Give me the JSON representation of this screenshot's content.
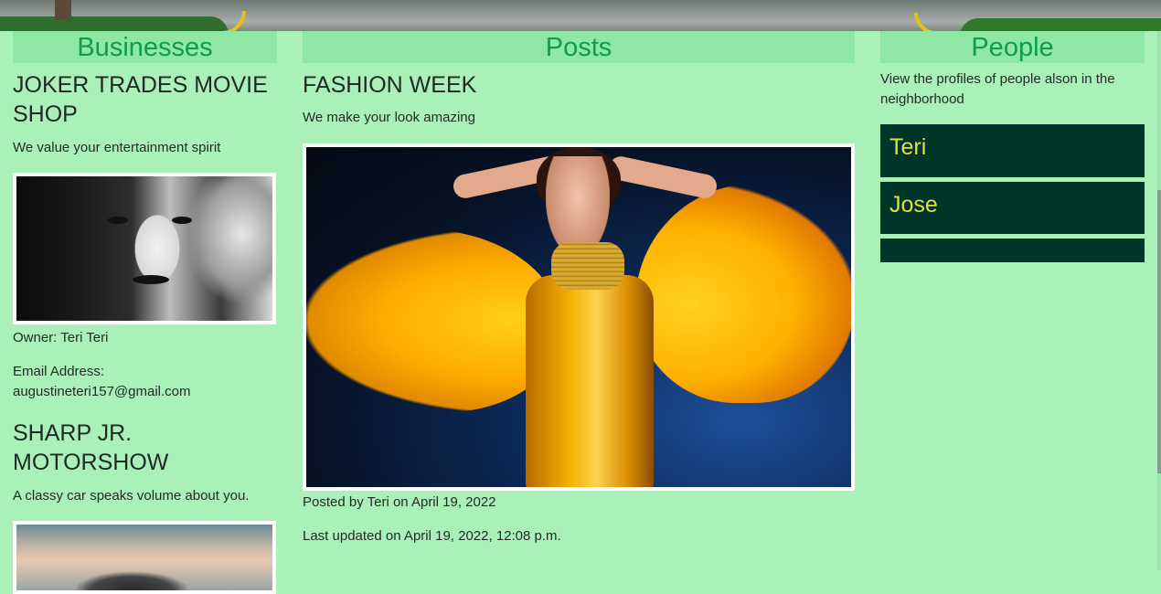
{
  "sections": {
    "businesses": "Businesses",
    "posts": "Posts",
    "people": "People"
  },
  "businesses": [
    {
      "name": "JOKER TRADES MOVIE SHOP",
      "tagline": "We value your entertainment spirit",
      "owner_text": "Owner: Teri Teri",
      "email_label": "Email Address:",
      "email": "augustineteri157@gmail.com"
    },
    {
      "name": "SHARP Jr. MOTORSHOW",
      "tagline": "A classy car speaks volume about you."
    }
  ],
  "posts": [
    {
      "title": "FASHION WEEK",
      "subtitle": "We make your look amazing",
      "posted_by": "Posted by Teri on April 19, 2022",
      "updated": "Last updated on April 19, 2022, 12:08 p.m."
    }
  ],
  "people": {
    "intro": "View the profiles of people alson in the neighborhood",
    "list": [
      "Teri",
      "Jose",
      ""
    ]
  },
  "colors": {
    "page_bg": "#aaf0b9",
    "section_head_bg": "#8fe7a6",
    "section_head_text": "#0f9a4f",
    "person_bg": "#00352a",
    "person_text": "#e8de3a"
  }
}
